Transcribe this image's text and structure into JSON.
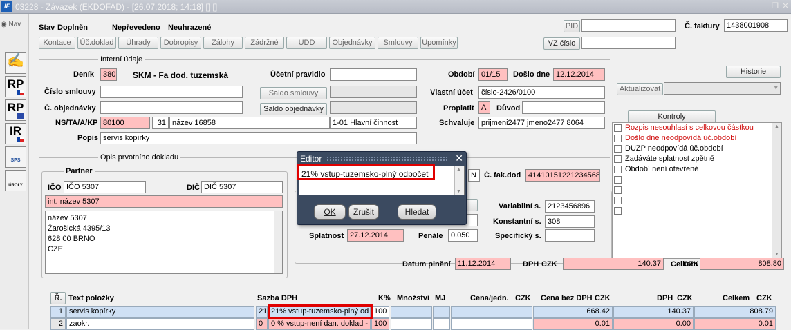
{
  "window": {
    "title": "03228 - Závazek (EKDOFAD) - [26.07.2018; 14:18] [] []",
    "logo": "IF",
    "restore_icon": "restore-icon",
    "close_icon": "close-icon"
  },
  "nav": {
    "label": "Nav"
  },
  "left_toolbar": [
    {
      "name": "hand-icon",
      "text": "✍"
    },
    {
      "name": "rp-cz",
      "text": "RP"
    },
    {
      "name": "rp-eu",
      "text": "RP"
    },
    {
      "name": "ir-cz",
      "text": "IR"
    },
    {
      "name": "sps",
      "text": "SPS"
    },
    {
      "name": "uroly",
      "text": "ÚROLY"
    }
  ],
  "status": {
    "stav_label": "Stav",
    "stav_value": "Doplněn",
    "neprevedeno": "Nepřevedeno",
    "neuhrazene": "Neuhrazené"
  },
  "tabs": [
    "Kontace",
    "Úč.doklad",
    "Úhrady",
    "Dobropisy",
    "Zálohy",
    "Zádržné",
    "UDD",
    "Objednávky",
    "Smlouvy",
    "Upomínky"
  ],
  "header_right": {
    "pid_label": "PID",
    "pid_value": "",
    "vz_cislo_label": "VZ číslo",
    "vz_value": "",
    "cislo_faktury_label": "Č. faktury",
    "cislo_faktury_value": "1438001908"
  },
  "interni": {
    "section_title": "Interní údaje",
    "denik_label": "Deník",
    "denik_code": "380",
    "denik_name": "SKM - Fa dod. tuzemská",
    "ucetni_pravidlo_label": "Účetní pravidlo",
    "ucetni_pravidlo_value": "",
    "cislo_smlouvy_label": "Číslo smlouvy",
    "saldo_smlouvy": "Saldo smlouvy",
    "c_objednavky_label": "Č. objednávky",
    "saldo_objednavky": "Saldo objednávky",
    "ns_label": "NS/TA/A/KP",
    "ns_value": "80100",
    "ta_value": "31",
    "nazev_value": "název 16858",
    "kp_value": "1-01 Hlavní činnost",
    "popis_label": "Popis",
    "popis_value": "servis kopírky",
    "obdobi_label": "Období",
    "obdobi_value": "01/15",
    "doslo_dne_label": "Došlo dne",
    "doslo_dne_value": "12.12.2014",
    "vlastni_ucet_label": "Vlastní účet",
    "vlastni_ucet_value": "číslo-2426/0100",
    "proplatit_label": "Proplatit",
    "proplatit_value": "A",
    "duvod_label": "Důvod",
    "duvod_value": "",
    "schvaluje_label": "Schvaluje",
    "schvaluje_value": "prijmeni2477 jmeno2477 8064"
  },
  "right_panel": {
    "historie": "Historie",
    "aktualizovat": "Aktualizovat",
    "kontroly_title": "Kontroly",
    "kontroly": [
      {
        "text": "Rozpis nesouhlasí s celkovou částkou",
        "color": "#d01010"
      },
      {
        "text": "Došlo dne neodpovídá úč.období",
        "color": "#d01010"
      },
      {
        "text": "DUZP neodpovídá úč.období",
        "color": "#000000"
      },
      {
        "text": "Zadáváte splatnost zpětně",
        "color": "#000000"
      },
      {
        "text": "Období není otevřené",
        "color": "#000000"
      }
    ]
  },
  "opis": {
    "section_title": "Opis prvotního dokladu",
    "partner_title": "Partner",
    "ico_label": "IČO",
    "ico_value": "IČO 5307",
    "dic_label": "DIČ",
    "dic_value": "DIČ 5307",
    "int_nazev": "int. název 5307",
    "address": [
      "název 5307",
      "Žarošická 4395/13",
      "628 00 BRNO",
      "CZE"
    ],
    "n_value": "N",
    "c_fak_dod_label": "Č. fak.dod",
    "c_fak_dod_value": "41410151221234568",
    "variabilni_label": "Variabilní s.",
    "variabilni_value": "2123456896",
    "konstantni_label": "Konstantní s.",
    "konstantni_value": "308",
    "specificky_label": "Specifický s.",
    "specificky_value": "",
    "splatnost_label": "Splatnost",
    "splatnost_value": "27.12.2014",
    "penale_label": "Penále",
    "penale_value": "0.050"
  },
  "totals": {
    "datum_plneni_label": "Datum plnění",
    "datum_plneni_value": "11.12.2014",
    "dph_label": "DPH",
    "czk": "CZK",
    "dph_value": "140.37",
    "celkem_label": "Celkem",
    "celkem_value": "808.80"
  },
  "editor": {
    "title": "Editor",
    "text": "21% vstup-tuzemsko-plný odpočet",
    "ok": "OK",
    "zrusit": "Zrušit",
    "hledat": "Hledat"
  },
  "table": {
    "headers": {
      "r": "Ř.",
      "text": "Text položky",
      "sazba": "Sazba DPH",
      "k": "K%",
      "mnozstvi": "Množství",
      "mj": "MJ",
      "cena": "Cena/jedn.",
      "cena_czk": "CZK",
      "bez": "Cena bez DPH",
      "bez_czk": "CZK",
      "dph": "DPH",
      "dph_czk": "CZK",
      "celkem": "Celkem",
      "celkem_czk": "CZK"
    },
    "rows": [
      {
        "r": "1",
        "text": "servis kopírky",
        "sazba_code": "21",
        "sazba": "21% vstup-tuzemsko-plný od",
        "k": "100",
        "bez": "668.42",
        "dph": "140.37",
        "celkem": "808.79"
      },
      {
        "r": "2",
        "text": "zaokr.",
        "sazba_code": "0",
        "sazba": "0 % vstup-není dan. doklad -",
        "k": "100",
        "bez": "0.01",
        "dph": "0.00",
        "celkem": "0.01"
      }
    ]
  }
}
